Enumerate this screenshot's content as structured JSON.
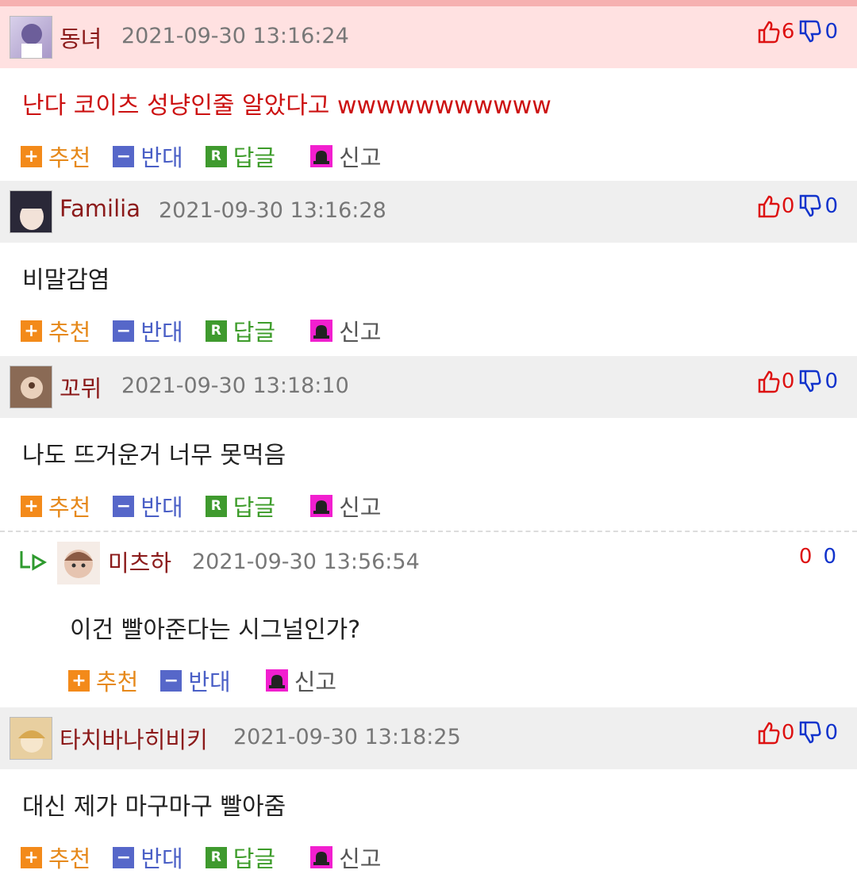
{
  "actions": {
    "recommend": "추천",
    "oppose": "반대",
    "reply": "답글",
    "report": "신고"
  },
  "comments": [
    {
      "nick": "동녀",
      "date": "2021-09-30 13:16:24",
      "up": "6",
      "down": "0",
      "text": "난다 코이츠 성냥인줄 알았다고 wwwwwwwwwww"
    },
    {
      "nick": "Familia",
      "date": "2021-09-30 13:16:28",
      "up": "0",
      "down": "0",
      "text": "비말감염"
    },
    {
      "nick": "꼬뮈",
      "date": "2021-09-30 13:18:10",
      "up": "0",
      "down": "0",
      "text": "나도 뜨거운거 너무 못먹음"
    },
    {
      "nick": "미츠하",
      "date": "2021-09-30 13:56:54",
      "up": "0",
      "down": "0",
      "text": "이건 빨아준다는 시그널인가?"
    },
    {
      "nick": "타치바나히비키",
      "date": "2021-09-30 13:18:25",
      "up": "0",
      "down": "0",
      "text": "대신 제가 마구마구 빨아줌"
    }
  ],
  "colors": {
    "best_header": "#ffe1e1",
    "header": "#efefef",
    "nick": "#8b1a1a",
    "upvote": "#dd1111",
    "downvote": "#1133cc"
  }
}
